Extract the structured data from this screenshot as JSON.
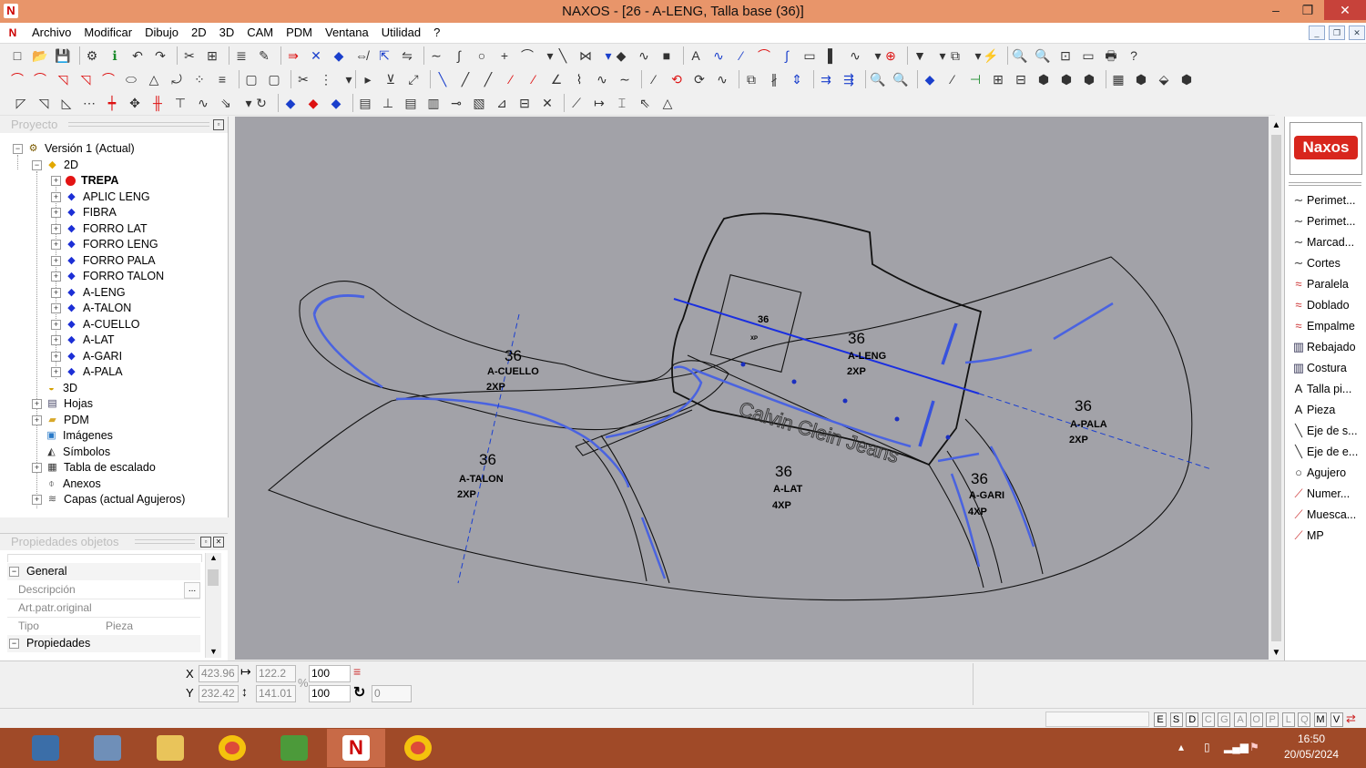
{
  "window": {
    "title": "NAXOS - [26 - A-LENG, Talla base (36)]",
    "min": "–",
    "restore": "❐",
    "close": "✕"
  },
  "menu": [
    "Archivo",
    "Modificar",
    "Dibujo",
    "2D",
    "3D",
    "CAM",
    "PDM",
    "Ventana",
    "Utilidad",
    "?"
  ],
  "project_panel": {
    "title": "Proyecto",
    "tree": [
      {
        "label": "Versión 1 (Actual)",
        "level": 0,
        "icon": "version-icon",
        "exp": "−"
      },
      {
        "label": "2D",
        "level": 1,
        "icon": "2d-icon",
        "exp": "−"
      },
      {
        "label": "TREPA",
        "level": 2,
        "icon": "red-dot-icon",
        "exp": "+",
        "bold": true
      },
      {
        "label": "APLIC LENG",
        "level": 2,
        "icon": "diamond-icon",
        "exp": "+"
      },
      {
        "label": "FIBRA",
        "level": 2,
        "icon": "diamond-icon",
        "exp": "+"
      },
      {
        "label": "FORRO LAT",
        "level": 2,
        "icon": "diamond-icon",
        "exp": "+"
      },
      {
        "label": "FORRO LENG",
        "level": 2,
        "icon": "diamond-icon",
        "exp": "+"
      },
      {
        "label": "FORRO PALA",
        "level": 2,
        "icon": "diamond-icon",
        "exp": "+"
      },
      {
        "label": "FORRO TALON",
        "level": 2,
        "icon": "diamond-icon",
        "exp": "+"
      },
      {
        "label": "A-LENG",
        "level": 2,
        "icon": "diamond-icon",
        "exp": "+"
      },
      {
        "label": "A-TALON",
        "level": 2,
        "icon": "diamond-icon",
        "exp": "+"
      },
      {
        "label": "A-CUELLO",
        "level": 2,
        "icon": "diamond-icon",
        "exp": "+"
      },
      {
        "label": "A-LAT",
        "level": 2,
        "icon": "diamond-icon",
        "exp": "+"
      },
      {
        "label": "A-GARI",
        "level": 2,
        "icon": "diamond-icon",
        "exp": "+"
      },
      {
        "label": "A-PALA",
        "level": 2,
        "icon": "diamond-icon",
        "exp": "+"
      },
      {
        "label": "3D",
        "level": 1,
        "icon": "3d-icon",
        "exp": ""
      },
      {
        "label": "Hojas",
        "level": 1,
        "icon": "sheets-icon",
        "exp": "+"
      },
      {
        "label": "PDM",
        "level": 1,
        "icon": "folder-icon",
        "exp": "+"
      },
      {
        "label": "Imágenes",
        "level": 1,
        "icon": "image-icon",
        "exp": ""
      },
      {
        "label": "Símbolos",
        "level": 1,
        "icon": "symbol-icon",
        "exp": ""
      },
      {
        "label": "Tabla de escalado",
        "level": 1,
        "icon": "table-icon",
        "exp": "+"
      },
      {
        "label": "Anexos",
        "level": 1,
        "icon": "clip-icon",
        "exp": ""
      },
      {
        "label": "Capas (actual Agujeros)",
        "level": 1,
        "icon": "layers-icon",
        "exp": "+"
      }
    ]
  },
  "properties_panel": {
    "title": "Propiedades objetos",
    "group_general": "General",
    "rows": [
      {
        "key": "Descripción",
        "value": "",
        "btn": "..."
      },
      {
        "key": "Art.patr.original",
        "value": ""
      },
      {
        "key": "Tipo",
        "value": "Pieza"
      }
    ],
    "group_props": "Propiedades"
  },
  "canvas": {
    "watermark_text": "Calvin Clein Jeans",
    "pieces": [
      {
        "size": "36",
        "name": "A-CUELLO",
        "count": "2XP"
      },
      {
        "size": "36",
        "name": "A-TALON",
        "count": "2XP"
      },
      {
        "size": "36",
        "name": "A-LENG",
        "count": "2XP"
      },
      {
        "size": "36",
        "name": "A-LAT",
        "count": "4XP"
      },
      {
        "size": "36",
        "name": "A-GARI",
        "count": "4XP"
      },
      {
        "size": "36",
        "name": "A-PALA",
        "count": "2XP"
      },
      {
        "size": "36",
        "name": "",
        "count": "XP"
      }
    ]
  },
  "right_panel": {
    "logo": "Naxos",
    "items": [
      {
        "label": "Perimet...",
        "icon": "curve-icon"
      },
      {
        "label": "Perimet...",
        "icon": "curve-icon"
      },
      {
        "label": "Marcad...",
        "icon": "curve-icon"
      },
      {
        "label": "Cortes",
        "icon": "curve-icon"
      },
      {
        "label": "Paralela",
        "icon": "parallel-icon"
      },
      {
        "label": "Doblado",
        "icon": "parallel-icon"
      },
      {
        "label": "Empalme",
        "icon": "parallel-icon"
      },
      {
        "label": "Rebajado",
        "icon": "stitch-icon"
      },
      {
        "label": "Costura",
        "icon": "stitch-icon"
      },
      {
        "label": "Talla pi...",
        "icon": "text-icon"
      },
      {
        "label": "Pieza",
        "icon": "text-icon"
      },
      {
        "label": "Eje de s...",
        "icon": "axis-icon"
      },
      {
        "label": "Eje de e...",
        "icon": "axis-icon"
      },
      {
        "label": "Agujero",
        "icon": "circle-icon"
      },
      {
        "label": "Numer...",
        "icon": "line-icon"
      },
      {
        "label": "Muesca...",
        "icon": "line-icon"
      },
      {
        "label": "MP",
        "icon": "line-icon"
      }
    ]
  },
  "coords": {
    "x_label": "X",
    "y_label": "Y",
    "x": "423.96",
    "y": "232.42",
    "w": "122.2",
    "h": "141.01",
    "sx": "100",
    "sy": "100",
    "pct": "%",
    "rot": "0"
  },
  "status_keys": [
    "E",
    "S",
    "D",
    "C",
    "G",
    "A",
    "O",
    "P",
    "L",
    "Q",
    "M",
    "V"
  ],
  "status_keys_on": [
    "E",
    "S",
    "D",
    "M",
    "V"
  ],
  "taskbar": {
    "time": "16:50",
    "date": "20/05/2024"
  }
}
